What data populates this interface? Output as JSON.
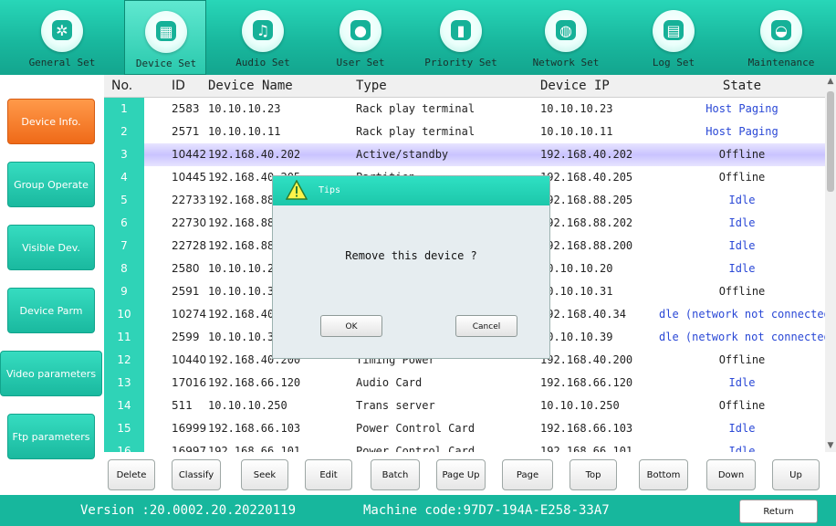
{
  "top_nav": [
    {
      "label": "General Set",
      "icon": "gear-icon",
      "glyph": "✲"
    },
    {
      "label": "Device Set",
      "icon": "device-grid-icon",
      "glyph": "▦",
      "active": true
    },
    {
      "label": "Audio Set",
      "icon": "music-note-icon",
      "glyph": "♫"
    },
    {
      "label": "User Set",
      "icon": "user-icon",
      "glyph": "●"
    },
    {
      "label": "Priority Set",
      "icon": "bar-chart-icon",
      "glyph": "▮"
    },
    {
      "label": "Network Set",
      "icon": "globe-icon",
      "glyph": "◍"
    },
    {
      "label": "Log  Set",
      "icon": "calendar-icon",
      "glyph": "▤"
    },
    {
      "label": "Maintenance",
      "icon": "globe-maintenance-icon",
      "glyph": "◒"
    }
  ],
  "left_nav": [
    {
      "label": "Device Info.",
      "active": true
    },
    {
      "label": "Group Operate"
    },
    {
      "label": "Visible Dev."
    },
    {
      "label": "Device Parm"
    },
    {
      "label": "Video parameters"
    },
    {
      "label": "Ftp parameters"
    }
  ],
  "table": {
    "headers": {
      "no": "No.",
      "id": "ID",
      "name": "Device Name",
      "type": "Type",
      "ip": "Device IP",
      "state": "State"
    },
    "rows": [
      {
        "no": "1",
        "id": "2583",
        "name": "10.10.10.23",
        "type": "Rack play terminal",
        "ip": "10.10.10.23",
        "state": "Host Paging"
      },
      {
        "no": "2",
        "id": "2571",
        "name": "10.10.10.11",
        "type": "Rack play terminal",
        "ip": "10.10.10.11",
        "state": "Host Paging"
      },
      {
        "no": "3",
        "id": "10442",
        "name": "192.168.40.202",
        "type": "Active/standby",
        "ip": "192.168.40.202",
        "state": "Offline",
        "selected": true
      },
      {
        "no": "4",
        "id": "10445",
        "name": "192.168.40.205",
        "type": "Partition",
        "ip": "192.168.40.205",
        "state": "Offline"
      },
      {
        "no": "5",
        "id": "22733",
        "name": "192.168.88.205",
        "type": "",
        "ip": "192.168.88.205",
        "state": "Idle"
      },
      {
        "no": "6",
        "id": "22730",
        "name": "192.168.88.202",
        "type": "",
        "ip": "192.168.88.202",
        "state": "Idle"
      },
      {
        "no": "7",
        "id": "22728",
        "name": "192.168.88.200",
        "type": "",
        "ip": "192.168.88.200",
        "state": "Idle"
      },
      {
        "no": "8",
        "id": "2580",
        "name": "10.10.10.20",
        "type": "",
        "ip": "10.10.10.20",
        "state": "Idle"
      },
      {
        "no": "9",
        "id": "2591",
        "name": "10.10.10.31",
        "type": "",
        "ip": "10.10.10.31",
        "state": "Offline"
      },
      {
        "no": "10",
        "id": "10274",
        "name": "192.168.40.34",
        "type": "",
        "ip": "192.168.40.34",
        "state": "dle (network not connected"
      },
      {
        "no": "11",
        "id": "2599",
        "name": "10.10.10.39",
        "type": "",
        "ip": "10.10.10.39",
        "state": "dle (network not connected"
      },
      {
        "no": "12",
        "id": "10440",
        "name": "192.168.40.200",
        "type": "Timing Power",
        "ip": "192.168.40.200",
        "state": "Offline"
      },
      {
        "no": "13",
        "id": "17016",
        "name": "192.168.66.120",
        "type": "Audio Card",
        "ip": "192.168.66.120",
        "state": "Idle"
      },
      {
        "no": "14",
        "id": "511",
        "name": "10.10.10.250",
        "type": "Trans server",
        "ip": "10.10.10.250",
        "state": "Offline"
      },
      {
        "no": "15",
        "id": "16999",
        "name": "192.168.66.103",
        "type": "Power Control Card",
        "ip": "192.168.66.103",
        "state": "Idle"
      },
      {
        "no": "16",
        "id": "16997",
        "name": "192.168.66.101",
        "type": "Power Control Card",
        "ip": "192.168.66.101",
        "state": "Idle"
      }
    ]
  },
  "actions": [
    "Delete",
    "Classify",
    "Seek",
    "Edit",
    "Batch",
    "Page Up",
    "Page Down",
    "Top",
    "Bottom",
    "Down",
    "Up"
  ],
  "footer": {
    "version": "Version :20.0002.20.20220119",
    "machine_code": "Machine code:97D7-194A-E258-33A7",
    "return_label": "Return"
  },
  "dialog": {
    "title": "Tips",
    "message": "Remove this device ?",
    "ok_label": "OK",
    "cancel_label": "Cancel"
  },
  "colors": {
    "accent": "#19b89e",
    "active_nav": "#ef6a18",
    "state_text": "#2a48d6",
    "selected_row": "#c9c3ff"
  }
}
